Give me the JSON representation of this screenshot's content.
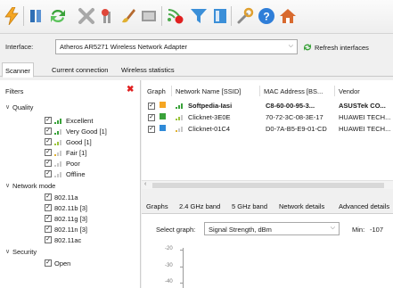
{
  "toolbar": {
    "buttons": [
      {
        "icon": "lightning-icon",
        "color": "#f5a623"
      },
      {
        "icon": "columns-icon",
        "color": "#2f6fb5"
      },
      {
        "icon": "refresh-arrows-icon",
        "color": "#3aa23a"
      },
      {
        "icon": "tools-x-icon",
        "color": "#9a9a9a"
      },
      {
        "icon": "filter-plus-icon",
        "color": "#e0473a"
      },
      {
        "icon": "brush-icon",
        "color": "#b56a2f"
      },
      {
        "icon": "table-icon",
        "color": "#7a7a7a"
      },
      {
        "icon": "signal-stop-icon",
        "color": "#4caa4c"
      },
      {
        "icon": "funnel-icon",
        "color": "#3b8fd8"
      },
      {
        "icon": "panel-icon",
        "color": "#3b8fd8"
      },
      {
        "icon": "wrench-icon",
        "color": "#8a8a8a"
      },
      {
        "icon": "help-icon",
        "color": "#2f7ed8"
      },
      {
        "icon": "home-icon",
        "color": "#d86a2f"
      }
    ]
  },
  "interface": {
    "label": "Interface:",
    "value": "Atheros AR5271 Wireless Network Adapter",
    "refresh_label": "Refresh interfaces"
  },
  "tabs": [
    "Scanner",
    "Current connection",
    "Wireless statistics"
  ],
  "filters": {
    "title": "Filters",
    "groups": [
      {
        "label": "Quality",
        "items": [
          "Excellent",
          "Very Good [1]",
          "Good [1]",
          "Fair [1]",
          "Poor",
          "Offline"
        ]
      },
      {
        "label": "Network mode",
        "items": [
          "802.11a",
          "802.11b [3]",
          "802.11g [3]",
          "802.11n [3]",
          "802.11ac"
        ]
      },
      {
        "label": "Security",
        "items": [
          "Open"
        ]
      }
    ]
  },
  "table": {
    "columns": [
      "Graph",
      "Network Name [SSID]",
      "MAC Address [BS...",
      "Vendor"
    ],
    "rows": [
      {
        "ssid": "Softpedia-Iasi",
        "mac": "C8-60-00-95-3...",
        "vendor": "ASUSTek CO...",
        "color": "#f5a623",
        "bold": true
      },
      {
        "ssid": "Clicknet-3E0E",
        "mac": "70-72-3C-08-3E-17",
        "vendor": "HUAWEI TECH...",
        "color": "#3aa23a",
        "bold": false
      },
      {
        "ssid": "Clicknet-01C4",
        "mac": "D0-7A-B5-E9-01-CD",
        "vendor": "HUAWEI TECH...",
        "color": "#2f8ad8",
        "bold": false
      }
    ]
  },
  "graph_tabs": [
    "Graphs",
    "2.4 GHz band",
    "5 GHz band",
    "Network details",
    "Advanced details"
  ],
  "graph": {
    "select_label": "Select graph:",
    "select_value": "Signal Strength, dBm",
    "min_label": "Min:",
    "min_value": "-107",
    "y_ticks": [
      "-20",
      "-30",
      "-40"
    ]
  },
  "accent": "#2f6fb5",
  "filter_close_color": "#e02020"
}
